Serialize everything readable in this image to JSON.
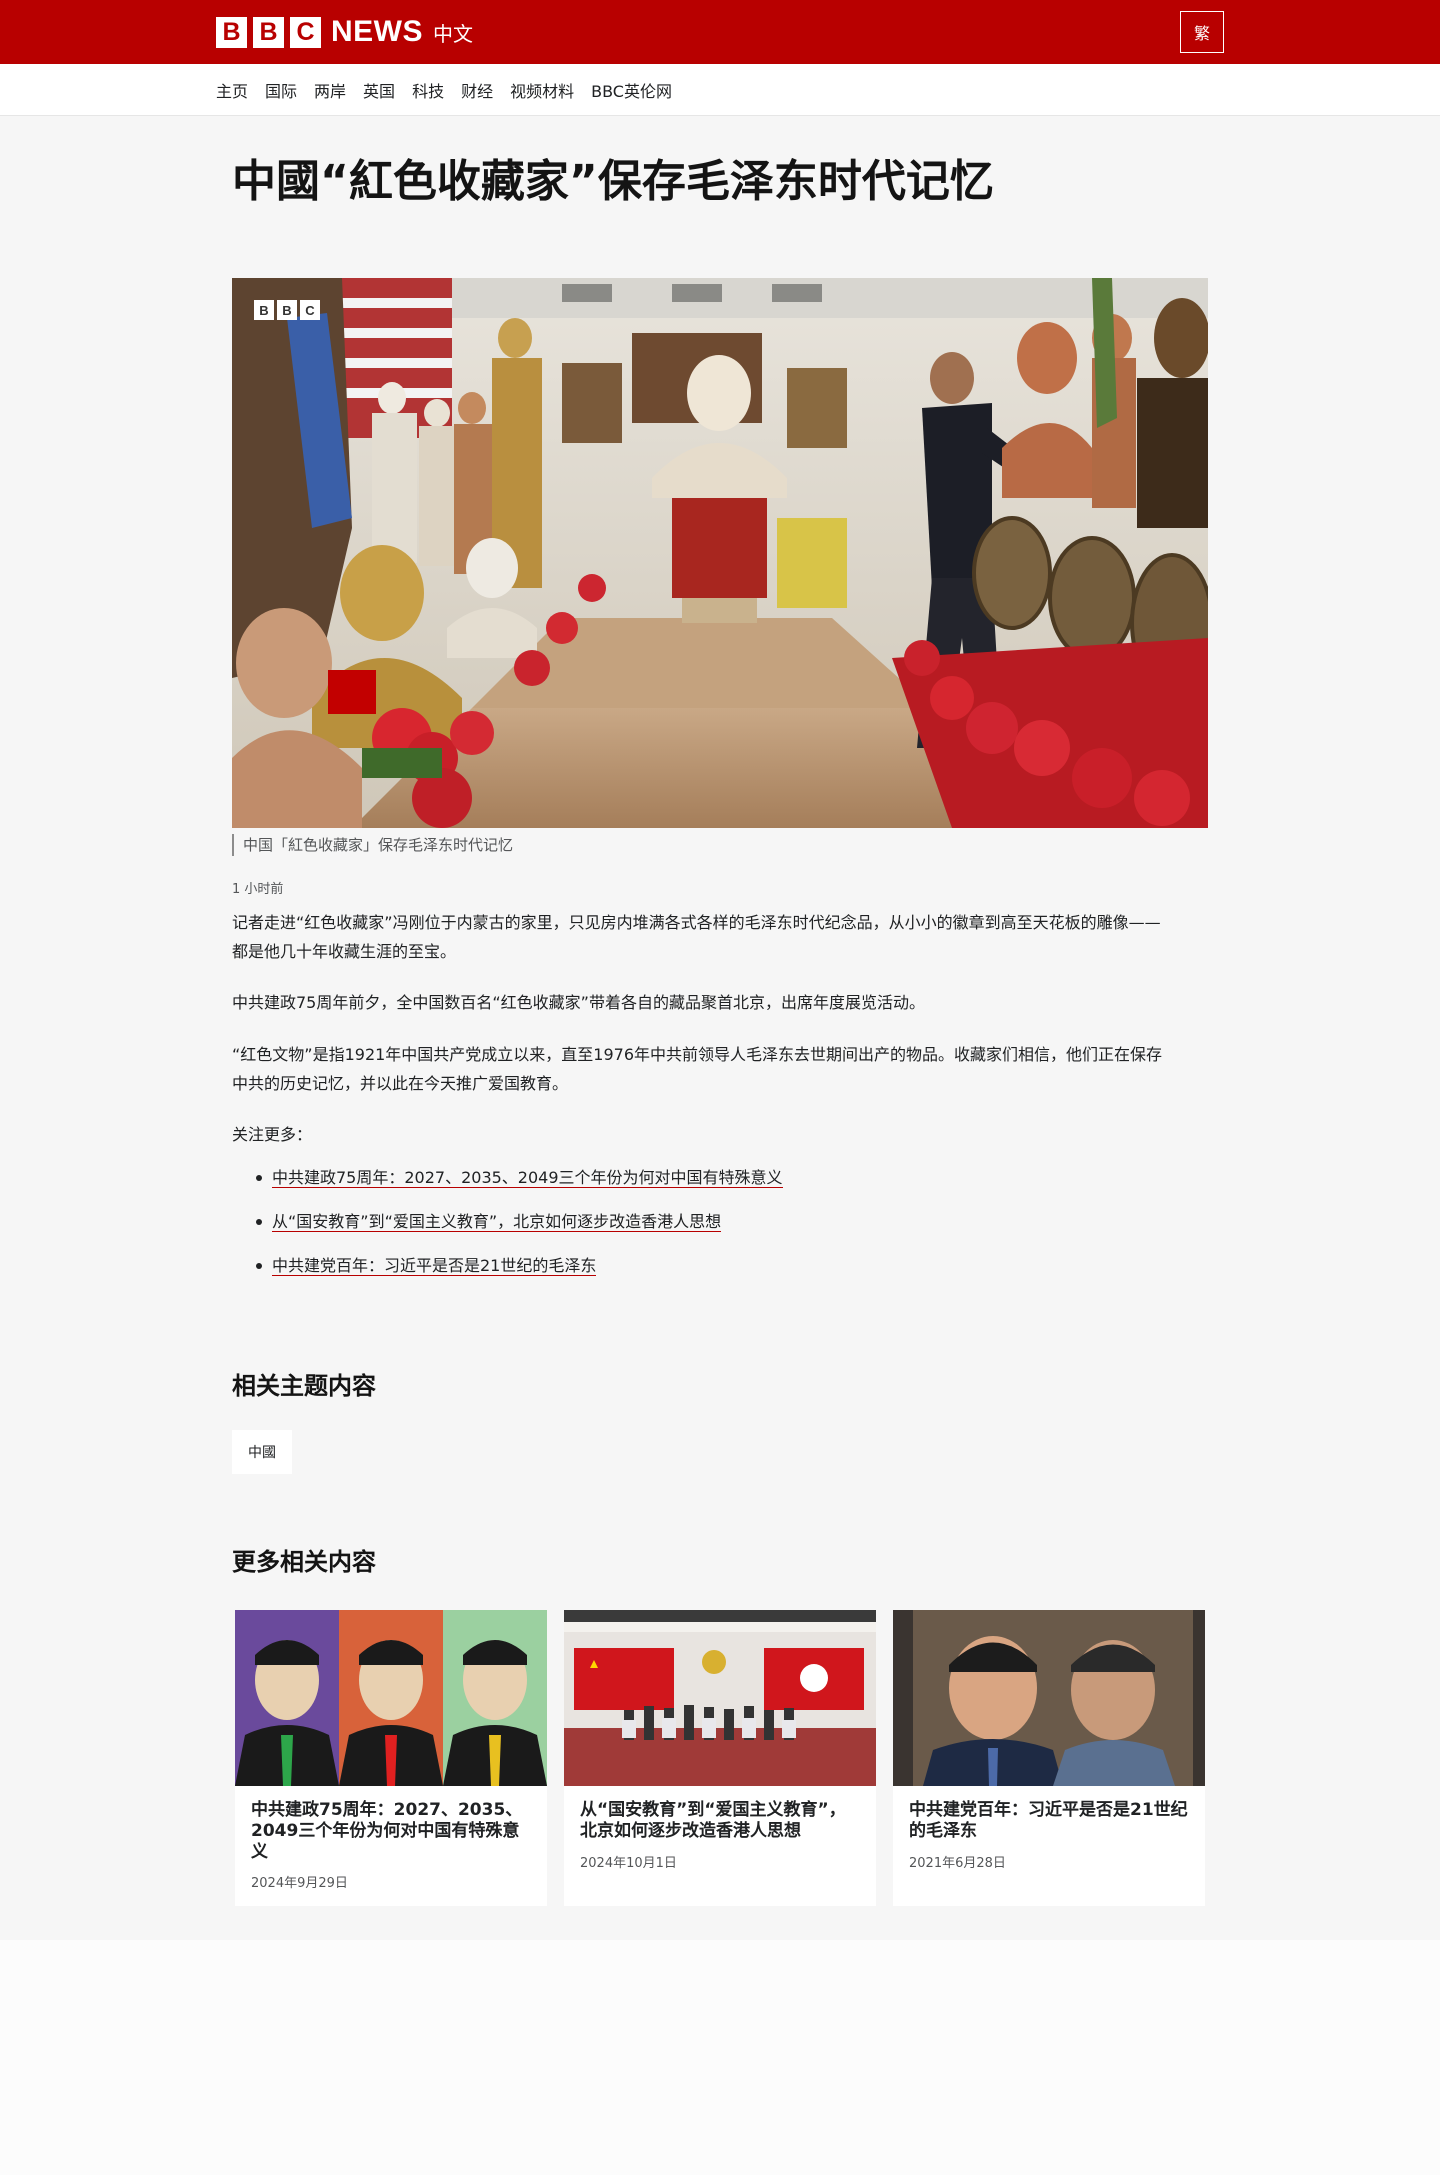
{
  "brand": {
    "box_letters": [
      "B",
      "B",
      "C"
    ],
    "news": "NEWS",
    "cn": "中文",
    "color": "#b80000"
  },
  "header": {
    "lang_toggle": "繁"
  },
  "nav": {
    "items": [
      "主页",
      "国际",
      "两岸",
      "英国",
      "科技",
      "财经",
      "视频材料",
      "BBC英伦网"
    ]
  },
  "article": {
    "headline": "中國“紅色收藏家”保存毛泽东时代记忆",
    "hero_caption": "中国「紅色收藏家」保存毛泽东时代记忆",
    "timestamp": "1 小时前",
    "paragraphs": [
      "记者走进“红色收藏家”冯刚位于内蒙古的家里，只见房内堆满各式各样的毛泽东时代纪念品，从小小的徽章到高至天花板的雕像——都是他几十年收藏生涯的至宝。",
      "中共建政75周年前夕，全中国数百名“红色收藏家”带着各自的藏品聚首北京，出席年度展览活动。",
      "“红色文物”是指1921年中国共产党成立以来，直至1976年中共前领导人毛泽东去世期间出产的物品。收藏家们相信，他们正在保存中共的历史记忆，并以此在今天推广爱国教育。",
      "关注更多："
    ],
    "links": [
      "中共建政75周年：2027、2035、2049三个年份为何对中国有特殊意义",
      "从“国安教育”到“爱国主义教育”，北京如何逐步改造香港人思想",
      "中共建党百年：习近平是否是21世纪的毛泽东"
    ]
  },
  "related_topics": {
    "heading": "相关主题内容",
    "tags": [
      "中國"
    ]
  },
  "more_related": {
    "heading": "更多相关内容",
    "cards": [
      {
        "title": "中共建政75周年：2027、2035、2049三个年份为何对中国有特殊意义",
        "date": "2024年9月29日"
      },
      {
        "title": "从“国安教育”到“爱国主义教育”，北京如何逐步改造香港人思想",
        "date": "2024年10月1日"
      },
      {
        "title": "中共建党百年：习近平是否是21世纪的毛泽东",
        "date": "2021年6月28日"
      }
    ]
  }
}
